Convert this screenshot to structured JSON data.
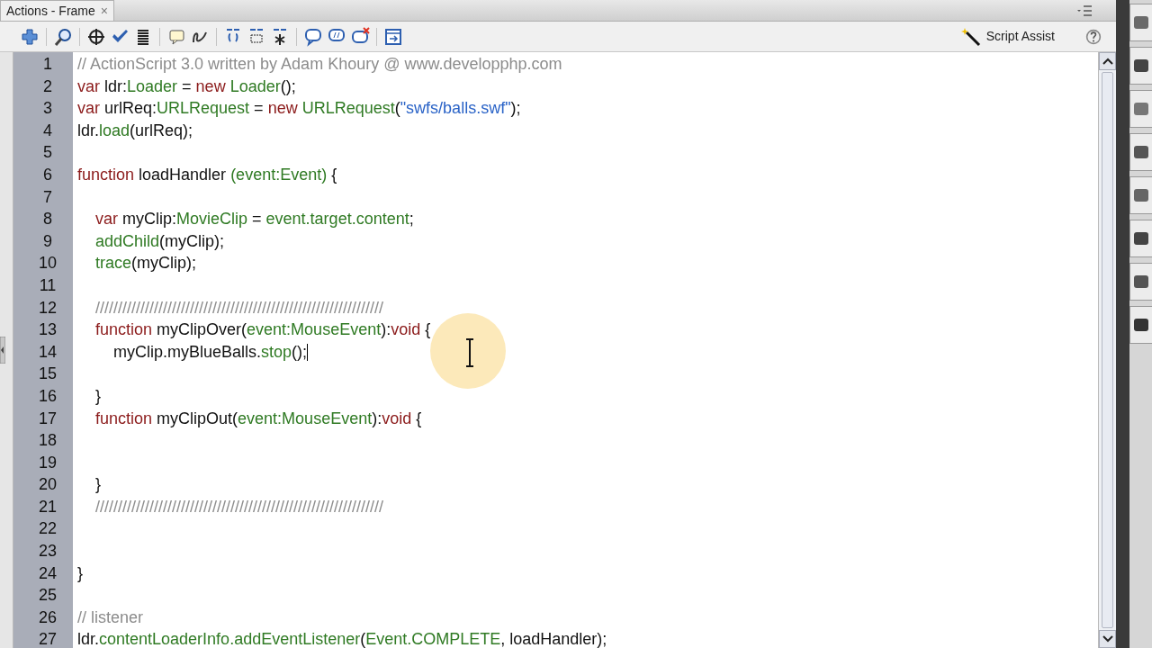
{
  "panel": {
    "tab": {
      "label": "Actions - Frame",
      "close": "×",
      "selected": true
    }
  },
  "toolbar": {
    "script_assist": "Script Assist"
  },
  "editor": {
    "lines": [
      {
        "number": "1",
        "tokens": [
          {
            "kind": "comment",
            "text": "// ActionScript 3.0 written by Adam Khoury @ www.developphp.com"
          }
        ]
      },
      {
        "number": "2",
        "tokens": [
          {
            "kind": "keyword",
            "text": "var"
          },
          {
            "kind": "plain",
            "text": " ldr:"
          },
          {
            "kind": "type",
            "text": "Loader"
          },
          {
            "kind": "plain",
            "text": " = "
          },
          {
            "kind": "keyword",
            "text": "new"
          },
          {
            "kind": "type",
            "text": " Loader"
          },
          {
            "kind": "plain",
            "text": "();"
          }
        ]
      },
      {
        "number": "3",
        "tokens": [
          {
            "kind": "keyword",
            "text": "var"
          },
          {
            "kind": "plain",
            "text": " urlReq:"
          },
          {
            "kind": "type",
            "text": "URLRequest"
          },
          {
            "kind": "plain",
            "text": " = "
          },
          {
            "kind": "keyword",
            "text": "new"
          },
          {
            "kind": "type",
            "text": " URLRequest"
          },
          {
            "kind": "plain",
            "text": "("
          },
          {
            "kind": "string",
            "text": "\"swfs/balls.swf\""
          },
          {
            "kind": "plain",
            "text": ");"
          }
        ]
      },
      {
        "number": "4",
        "tokens": [
          {
            "kind": "plain",
            "text": "ldr."
          },
          {
            "kind": "type",
            "text": "load"
          },
          {
            "kind": "plain",
            "text": "(urlReq);"
          }
        ]
      },
      {
        "number": "5"
      },
      {
        "number": "6",
        "tokens": [
          {
            "kind": "keyword",
            "text": "function"
          },
          {
            "kind": "plain",
            "text": " loadHandler "
          },
          {
            "kind": "type",
            "text": "(event:Event)"
          },
          {
            "kind": "plain",
            "text": " {"
          }
        ]
      },
      {
        "number": "7"
      },
      {
        "number": "8",
        "tokens": [
          {
            "kind": "keyword",
            "text": "    var"
          },
          {
            "kind": "plain",
            "text": " myClip:"
          },
          {
            "kind": "type",
            "text": "MovieClip"
          },
          {
            "kind": "plain",
            "text": " = "
          },
          {
            "kind": "type",
            "text": "event.target.content"
          },
          {
            "kind": "plain",
            "text": ";"
          }
        ]
      },
      {
        "number": "9",
        "tokens": [
          {
            "kind": "type",
            "text": "    addChild"
          },
          {
            "kind": "plain",
            "text": "(myClip);"
          }
        ]
      },
      {
        "number": "10",
        "tokens": [
          {
            "kind": "type",
            "text": "    trace"
          },
          {
            "kind": "plain",
            "text": "(myClip);"
          }
        ]
      },
      {
        "number": "11"
      },
      {
        "number": "12",
        "tokens": [
          {
            "kind": "comment",
            "text": "    ////////////////////////////////////////////////////////////////"
          }
        ]
      },
      {
        "number": "13",
        "tokens": [
          {
            "kind": "keyword",
            "text": "    function"
          },
          {
            "kind": "plain",
            "text": " myClipOver("
          },
          {
            "kind": "type",
            "text": "event:MouseEvent"
          },
          {
            "kind": "plain",
            "text": "):"
          },
          {
            "kind": "keyword",
            "text": "void"
          },
          {
            "kind": "plain",
            "text": " {"
          }
        ]
      },
      {
        "number": "14",
        "caret": true,
        "tokens": [
          {
            "kind": "plain",
            "text": "        myClip.myBlueBalls."
          },
          {
            "kind": "type",
            "text": "stop"
          },
          {
            "kind": "plain",
            "text": "();"
          }
        ]
      },
      {
        "number": "15"
      },
      {
        "number": "16",
        "tokens": [
          {
            "kind": "plain",
            "text": "    }"
          }
        ]
      },
      {
        "number": "17",
        "tokens": [
          {
            "kind": "keyword",
            "text": "    function"
          },
          {
            "kind": "plain",
            "text": " myClipOut("
          },
          {
            "kind": "type",
            "text": "event:MouseEvent"
          },
          {
            "kind": "plain",
            "text": "):"
          },
          {
            "kind": "keyword",
            "text": "void"
          },
          {
            "kind": "plain",
            "text": " {"
          }
        ]
      },
      {
        "number": "18"
      },
      {
        "number": "19"
      },
      {
        "number": "20",
        "tokens": [
          {
            "kind": "plain",
            "text": "    }"
          }
        ]
      },
      {
        "number": "21",
        "tokens": [
          {
            "kind": "comment",
            "text": "    ////////////////////////////////////////////////////////////////"
          }
        ]
      },
      {
        "number": "22"
      },
      {
        "number": "23"
      },
      {
        "number": "24",
        "tokens": [
          {
            "kind": "plain",
            "text": "}"
          }
        ]
      },
      {
        "number": "25"
      },
      {
        "number": "26",
        "tokens": [
          {
            "kind": "comment",
            "text": "// listener"
          }
        ]
      },
      {
        "number": "27",
        "tokens": [
          {
            "kind": "plain",
            "text": "ldr."
          },
          {
            "kind": "type",
            "text": "contentLoaderInfo.addEventListener"
          },
          {
            "kind": "plain",
            "text": "("
          },
          {
            "kind": "type",
            "text": "Event.COMPLETE"
          },
          {
            "kind": "plain",
            "text": ", loadHandler);"
          }
        ]
      }
    ]
  }
}
